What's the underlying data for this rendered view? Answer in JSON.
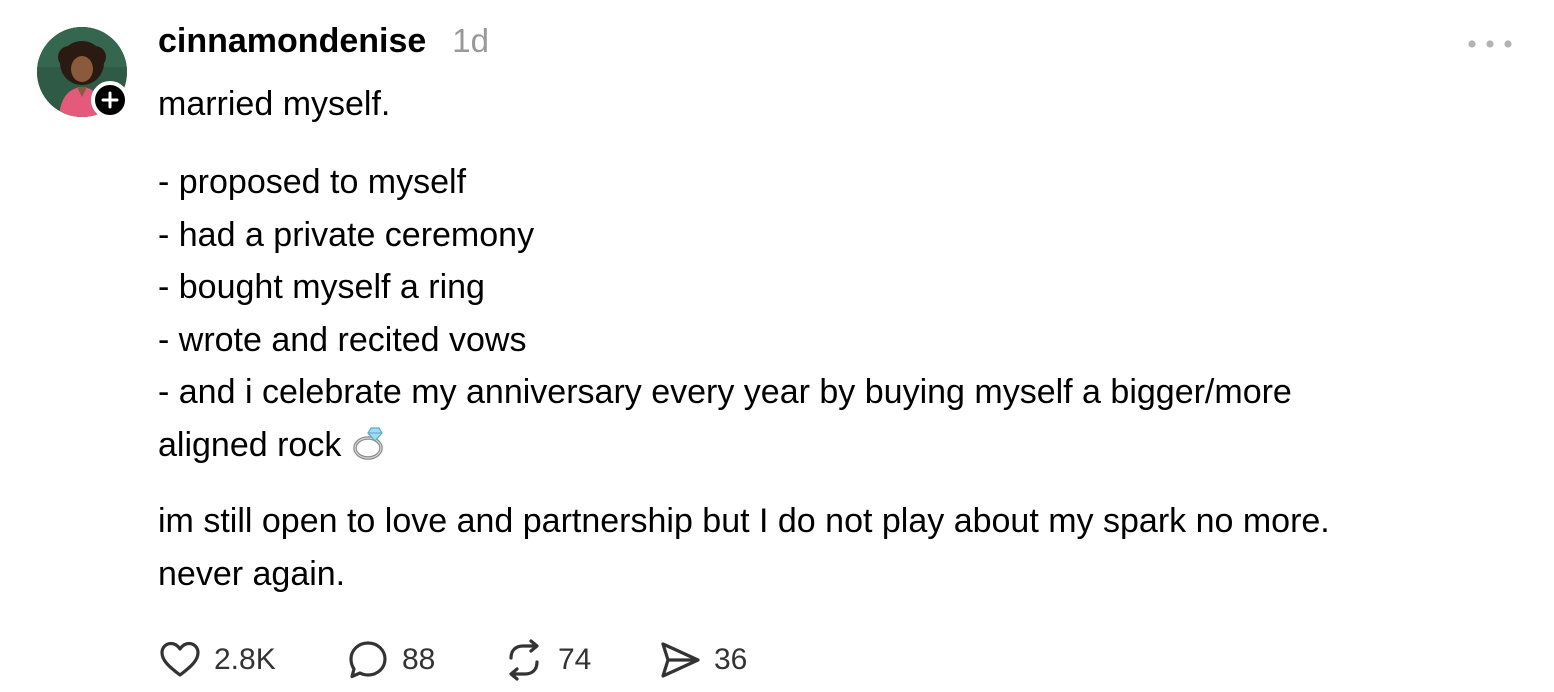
{
  "post": {
    "author": {
      "username": "cinnamondenise",
      "avatar_icon": "profile-photo"
    },
    "timestamp": "1d",
    "more_icon": "more-icon",
    "text": {
      "line1": "married myself.",
      "list": [
        "- proposed to myself",
        "- had a private ceremony",
        "- bought myself a ring",
        "- wrote and recited vows",
        "- and i celebrate my anniversary every year by buying myself a bigger/more"
      ],
      "list_continuation": "aligned rock",
      "emoji": "ring-emoji",
      "paragraph": [
        "im still open to love and partnership but I do not play about my spark no more.",
        "never again."
      ]
    },
    "actions": {
      "likes": "2.8K",
      "replies": "88",
      "reposts": "74",
      "shares": "36"
    }
  },
  "colors": {
    "text": "#000000",
    "muted": "#999999",
    "badge": "#000000"
  }
}
